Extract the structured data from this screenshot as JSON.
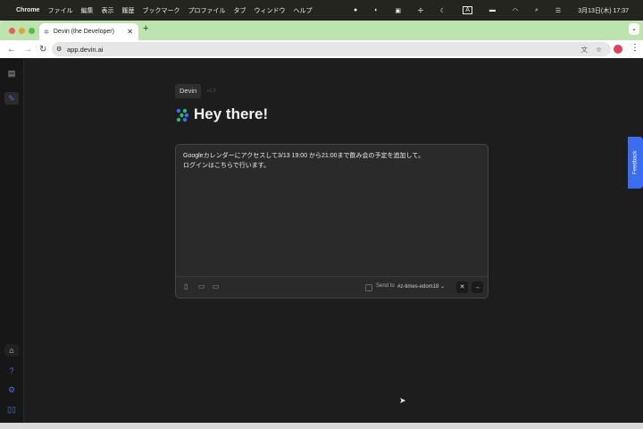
{
  "menubar": {
    "app": "Chrome",
    "items": [
      "ファイル",
      "編集",
      "表示",
      "履歴",
      "ブックマーク",
      "プロファイル",
      "タブ",
      "ウィンドウ",
      "ヘルプ"
    ],
    "clock": "3月13日(木) 17:37",
    "input_mode": "A"
  },
  "browser": {
    "tab_title": "Devin (the Developer)",
    "url": "app.devin.ai"
  },
  "page": {
    "pill": "Devin",
    "version": "v1.3",
    "heading": "Hey there!",
    "message_line1": "Googleカレンダーにアクセスして3/13 19:00 から21:00まで飲み会の予定を追加して。",
    "message_line2": "ログインはこちらで行います。",
    "send_to_label": "Send to",
    "channel": "#z-times-edom18"
  },
  "feedback": "Feedback",
  "colors": {
    "accent": "#3b6df0",
    "tabstrip": "#bde4ae",
    "background": "#1d1d1d"
  }
}
